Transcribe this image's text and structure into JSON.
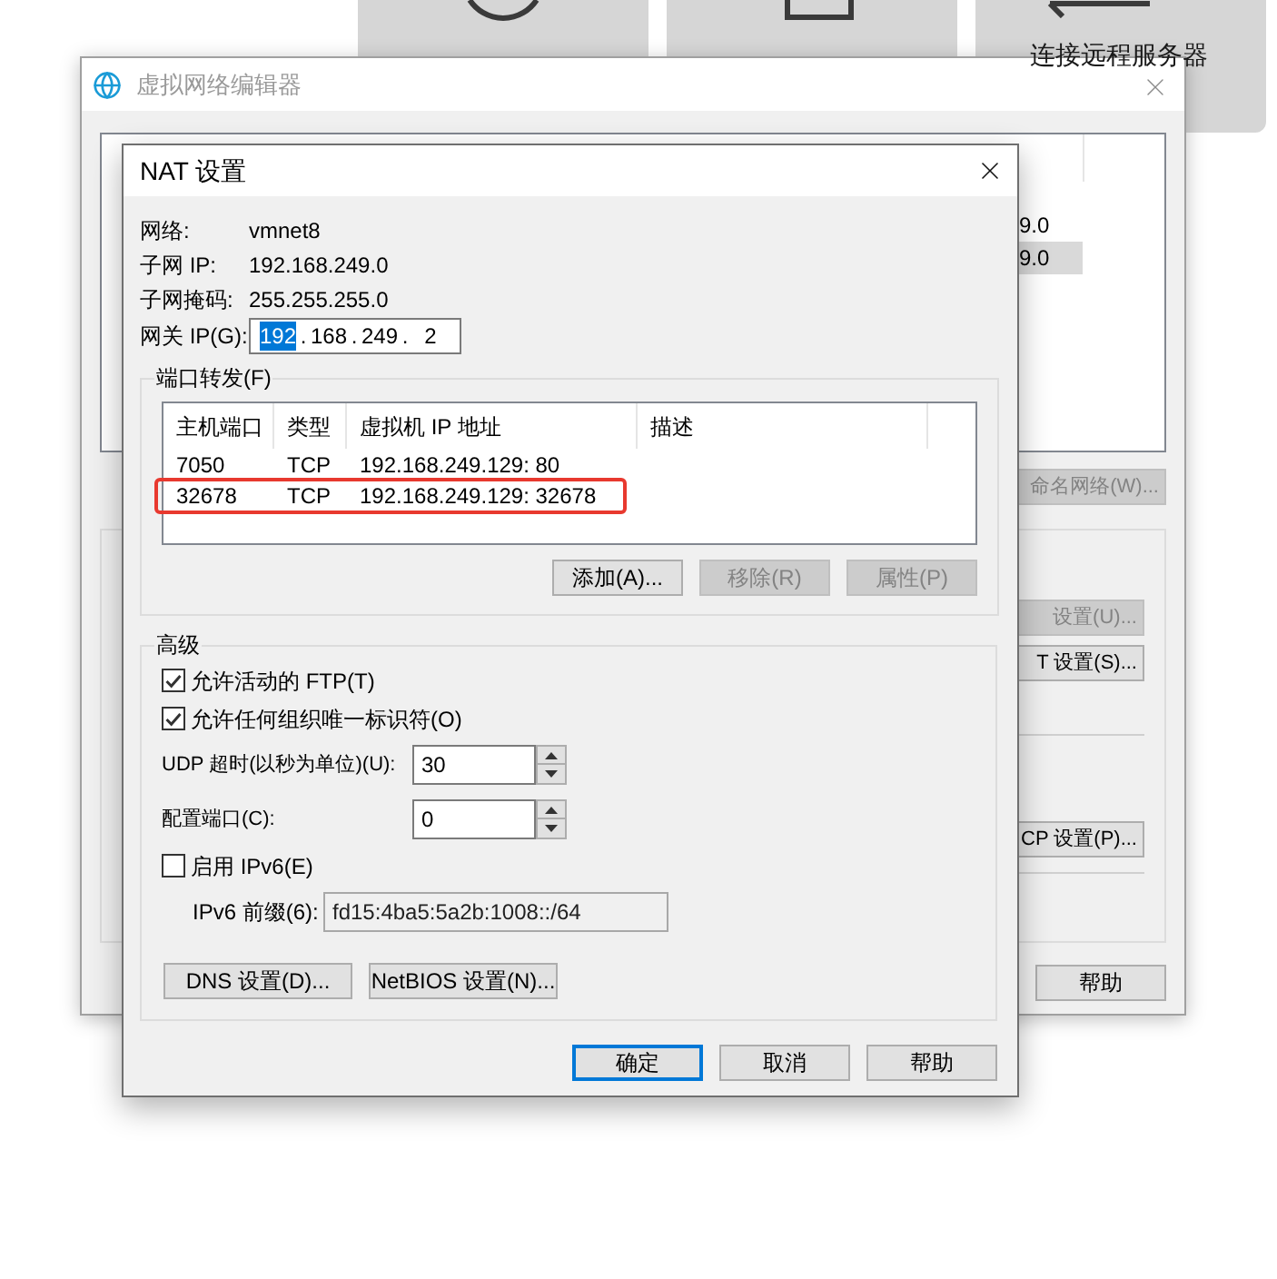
{
  "home_tiles": [
    {
      "kind": "circle"
    },
    {
      "kind": "square"
    },
    {
      "kind": "arrow",
      "label": "连接远程服务器"
    }
  ],
  "network_editor": {
    "title": "虚拟网络编辑器",
    "list_rows": [
      {
        "subnet": "9.0",
        "selected": false
      },
      {
        "subnet": "9.0",
        "selected": true
      }
    ],
    "rename_button": {
      "label": "命名网络(W)...",
      "disabled": true
    },
    "settings_buttons": [
      {
        "label": "设置(U)...",
        "disabled": true
      },
      {
        "label": "T 设置(S)...",
        "disabled": false
      },
      {
        "label": "CP 设置(P)...",
        "disabled": false
      }
    ],
    "help_button": "帮助"
  },
  "nat_dialog": {
    "title": "NAT 设置",
    "info": [
      {
        "label": "网络:",
        "value": "vmnet8"
      },
      {
        "label": "子网 IP:",
        "value": "192.168.249.0"
      },
      {
        "label": "子网掩码:",
        "value": "255.255.255.0"
      }
    ],
    "gateway": {
      "label": "网关 IP(G):",
      "separator": ".",
      "octets": [
        {
          "value": "192",
          "selected": true
        },
        {
          "value": "168",
          "selected": false
        },
        {
          "value": "249",
          "selected": false
        },
        {
          "value": "2",
          "selected": false
        }
      ]
    },
    "port_forwarding": {
      "title": "端口转发(F)",
      "columns": [
        "主机端口",
        "类型",
        "虚拟机 IP 地址",
        "描述"
      ],
      "rows": [
        {
          "cells": [
            "7050",
            "TCP",
            "192.168.249.129: 80"
          ],
          "highlighted": false
        },
        {
          "cells": [
            "32678",
            "TCP",
            "192.168.249.129: 32678"
          ],
          "highlighted": true
        }
      ],
      "buttons": [
        {
          "label": "添加(A)...",
          "disabled": false
        },
        {
          "label": "移除(R)",
          "disabled": true
        },
        {
          "label": "属性(P)",
          "disabled": true
        }
      ]
    },
    "advanced": {
      "title": "高级",
      "items": [
        {
          "kind": "checkbox",
          "label": "允许活动的 FTP(T)",
          "checked": true
        },
        {
          "kind": "checkbox",
          "label": "允许任何组织唯一标识符(O)",
          "checked": true
        },
        {
          "kind": "spinner",
          "label": "UDP 超时(以秒为单位)(U):",
          "value": "30"
        },
        {
          "kind": "spinner",
          "label": "配置端口(C):",
          "value": "0"
        },
        {
          "kind": "checkbox",
          "label": "启用 IPv6(E)",
          "checked": false
        },
        {
          "kind": "prefix",
          "label": "IPv6 前缀(6):",
          "value": "fd15:4ba5:5a2b:1008::/64",
          "disabled": true
        }
      ],
      "buttons": [
        "DNS 设置(D)...",
        "NetBIOS 设置(N)..."
      ]
    },
    "buttons": [
      {
        "label": "确定",
        "default": true
      },
      {
        "label": "取消",
        "default": false
      },
      {
        "label": "帮助",
        "default": false
      }
    ]
  }
}
